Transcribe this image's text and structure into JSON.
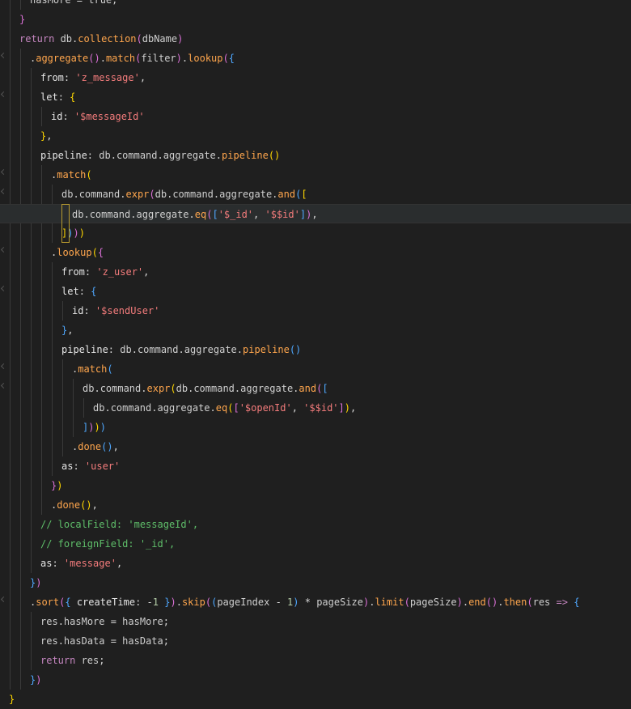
{
  "editor": {
    "lines": [
      {
        "indent": 3,
        "tokens": [
          {
            "t": "hasMore = true;",
            "c": "default"
          }
        ]
      },
      {
        "indent": 2,
        "tokens": [
          {
            "t": "}",
            "c": "bracket2"
          }
        ]
      },
      {
        "indent": 2,
        "tokens": [
          {
            "t": "return ",
            "c": "keyword"
          },
          {
            "t": "db",
            "c": "default"
          },
          {
            "t": ".",
            "c": "punct"
          },
          {
            "t": "collection",
            "c": "function"
          },
          {
            "t": "(",
            "c": "bracket2"
          },
          {
            "t": "dbName",
            "c": "default"
          },
          {
            "t": ")",
            "c": "bracket2"
          }
        ]
      },
      {
        "indent": 3,
        "fold": true,
        "tokens": [
          {
            "t": ".",
            "c": "punct"
          },
          {
            "t": "aggregate",
            "c": "function"
          },
          {
            "t": "()",
            "c": "bracket2"
          },
          {
            "t": ".",
            "c": "punct"
          },
          {
            "t": "match",
            "c": "function"
          },
          {
            "t": "(",
            "c": "bracket2"
          },
          {
            "t": "filter",
            "c": "default"
          },
          {
            "t": ")",
            "c": "bracket2"
          },
          {
            "t": ".",
            "c": "punct"
          },
          {
            "t": "lookup",
            "c": "function"
          },
          {
            "t": "(",
            "c": "bracket2"
          },
          {
            "t": "{",
            "c": "bracket3"
          }
        ]
      },
      {
        "indent": 4,
        "tokens": [
          {
            "t": "from",
            "c": "property"
          },
          {
            "t": ": ",
            "c": "punct"
          },
          {
            "t": "'z_message'",
            "c": "string"
          },
          {
            "t": ",",
            "c": "punct"
          }
        ]
      },
      {
        "indent": 4,
        "fold": true,
        "tokens": [
          {
            "t": "let",
            "c": "property"
          },
          {
            "t": ": ",
            "c": "punct"
          },
          {
            "t": "{",
            "c": "bracket1"
          }
        ]
      },
      {
        "indent": 5,
        "tokens": [
          {
            "t": "id",
            "c": "property"
          },
          {
            "t": ": ",
            "c": "punct"
          },
          {
            "t": "'$messageId'",
            "c": "string"
          }
        ]
      },
      {
        "indent": 4,
        "tokens": [
          {
            "t": "}",
            "c": "bracket1"
          },
          {
            "t": ",",
            "c": "punct"
          }
        ]
      },
      {
        "indent": 4,
        "tokens": [
          {
            "t": "pipeline",
            "c": "property"
          },
          {
            "t": ": ",
            "c": "punct"
          },
          {
            "t": "db",
            "c": "default"
          },
          {
            "t": ".",
            "c": "punct"
          },
          {
            "t": "command",
            "c": "default"
          },
          {
            "t": ".",
            "c": "punct"
          },
          {
            "t": "aggregate",
            "c": "default"
          },
          {
            "t": ".",
            "c": "punct"
          },
          {
            "t": "pipeline",
            "c": "function"
          },
          {
            "t": "()",
            "c": "bracket1"
          }
        ]
      },
      {
        "indent": 5,
        "fold": true,
        "tokens": [
          {
            "t": ".",
            "c": "punct"
          },
          {
            "t": "match",
            "c": "function"
          },
          {
            "t": "(",
            "c": "bracket1"
          }
        ]
      },
      {
        "indent": 6,
        "fold": true,
        "tokens": [
          {
            "t": "db",
            "c": "default"
          },
          {
            "t": ".",
            "c": "punct"
          },
          {
            "t": "command",
            "c": "default"
          },
          {
            "t": ".",
            "c": "punct"
          },
          {
            "t": "expr",
            "c": "function"
          },
          {
            "t": "(",
            "c": "bracket2"
          },
          {
            "t": "db",
            "c": "default"
          },
          {
            "t": ".",
            "c": "punct"
          },
          {
            "t": "command",
            "c": "default"
          },
          {
            "t": ".",
            "c": "punct"
          },
          {
            "t": "aggregate",
            "c": "default"
          },
          {
            "t": ".",
            "c": "punct"
          },
          {
            "t": "and",
            "c": "function"
          },
          {
            "t": "(",
            "c": "bracket3"
          },
          {
            "t": "[",
            "c": "bracket1"
          }
        ]
      },
      {
        "indent": 7,
        "current": true,
        "tokens": [
          {
            "t": "db",
            "c": "default"
          },
          {
            "t": ".",
            "c": "punct"
          },
          {
            "t": "command",
            "c": "default"
          },
          {
            "t": ".",
            "c": "punct"
          },
          {
            "t": "aggregate",
            "c": "default"
          },
          {
            "t": ".",
            "c": "punct"
          },
          {
            "t": "eq",
            "c": "function"
          },
          {
            "t": "(",
            "c": "bracket2"
          },
          {
            "t": "[",
            "c": "bracket3"
          },
          {
            "t": "'$_id'",
            "c": "string"
          },
          {
            "t": ", ",
            "c": "punct"
          },
          {
            "t": "'$$id'",
            "c": "string"
          },
          {
            "t": "]",
            "c": "bracket3"
          },
          {
            "t": ")",
            "c": "bracket2"
          },
          {
            "t": ",",
            "c": "punct"
          }
        ]
      },
      {
        "indent": 6,
        "tokens": [
          {
            "t": "]",
            "c": "bracket1"
          },
          {
            "t": ")",
            "c": "bracket3"
          },
          {
            "t": ")",
            "c": "bracket2"
          },
          {
            "t": ")",
            "c": "bracket1"
          }
        ]
      },
      {
        "indent": 5,
        "fold": true,
        "tokens": [
          {
            "t": ".",
            "c": "punct"
          },
          {
            "t": "lookup",
            "c": "function"
          },
          {
            "t": "(",
            "c": "bracket1"
          },
          {
            "t": "{",
            "c": "bracket2"
          }
        ]
      },
      {
        "indent": 6,
        "tokens": [
          {
            "t": "from",
            "c": "property"
          },
          {
            "t": ": ",
            "c": "punct"
          },
          {
            "t": "'z_user'",
            "c": "string"
          },
          {
            "t": ",",
            "c": "punct"
          }
        ]
      },
      {
        "indent": 6,
        "fold": true,
        "tokens": [
          {
            "t": "let",
            "c": "property"
          },
          {
            "t": ": ",
            "c": "punct"
          },
          {
            "t": "{",
            "c": "bracket3"
          }
        ]
      },
      {
        "indent": 7,
        "tokens": [
          {
            "t": "id",
            "c": "property"
          },
          {
            "t": ": ",
            "c": "punct"
          },
          {
            "t": "'$sendUser'",
            "c": "string"
          }
        ]
      },
      {
        "indent": 6,
        "tokens": [
          {
            "t": "}",
            "c": "bracket3"
          },
          {
            "t": ",",
            "c": "punct"
          }
        ]
      },
      {
        "indent": 6,
        "tokens": [
          {
            "t": "pipeline",
            "c": "property"
          },
          {
            "t": ": ",
            "c": "punct"
          },
          {
            "t": "db",
            "c": "default"
          },
          {
            "t": ".",
            "c": "punct"
          },
          {
            "t": "command",
            "c": "default"
          },
          {
            "t": ".",
            "c": "punct"
          },
          {
            "t": "aggregate",
            "c": "default"
          },
          {
            "t": ".",
            "c": "punct"
          },
          {
            "t": "pipeline",
            "c": "function"
          },
          {
            "t": "()",
            "c": "bracket3"
          }
        ]
      },
      {
        "indent": 7,
        "fold": true,
        "tokens": [
          {
            "t": ".",
            "c": "punct"
          },
          {
            "t": "match",
            "c": "function"
          },
          {
            "t": "(",
            "c": "bracket3"
          }
        ]
      },
      {
        "indent": 8,
        "fold": true,
        "tokens": [
          {
            "t": "db",
            "c": "default"
          },
          {
            "t": ".",
            "c": "punct"
          },
          {
            "t": "command",
            "c": "default"
          },
          {
            "t": ".",
            "c": "punct"
          },
          {
            "t": "expr",
            "c": "function"
          },
          {
            "t": "(",
            "c": "bracket1"
          },
          {
            "t": "db",
            "c": "default"
          },
          {
            "t": ".",
            "c": "punct"
          },
          {
            "t": "command",
            "c": "default"
          },
          {
            "t": ".",
            "c": "punct"
          },
          {
            "t": "aggregate",
            "c": "default"
          },
          {
            "t": ".",
            "c": "punct"
          },
          {
            "t": "and",
            "c": "function"
          },
          {
            "t": "(",
            "c": "bracket2"
          },
          {
            "t": "[",
            "c": "bracket3"
          }
        ]
      },
      {
        "indent": 9,
        "tokens": [
          {
            "t": "db",
            "c": "default"
          },
          {
            "t": ".",
            "c": "punct"
          },
          {
            "t": "command",
            "c": "default"
          },
          {
            "t": ".",
            "c": "punct"
          },
          {
            "t": "aggregate",
            "c": "default"
          },
          {
            "t": ".",
            "c": "punct"
          },
          {
            "t": "eq",
            "c": "function"
          },
          {
            "t": "(",
            "c": "bracket1"
          },
          {
            "t": "[",
            "c": "bracket2"
          },
          {
            "t": "'$openId'",
            "c": "string"
          },
          {
            "t": ", ",
            "c": "punct"
          },
          {
            "t": "'$$id'",
            "c": "string"
          },
          {
            "t": "]",
            "c": "bracket2"
          },
          {
            "t": ")",
            "c": "bracket1"
          },
          {
            "t": ",",
            "c": "punct"
          }
        ]
      },
      {
        "indent": 8,
        "tokens": [
          {
            "t": "]",
            "c": "bracket3"
          },
          {
            "t": ")",
            "c": "bracket2"
          },
          {
            "t": ")",
            "c": "bracket1"
          },
          {
            "t": ")",
            "c": "bracket3"
          }
        ]
      },
      {
        "indent": 7,
        "tokens": [
          {
            "t": ".",
            "c": "punct"
          },
          {
            "t": "done",
            "c": "function"
          },
          {
            "t": "()",
            "c": "bracket3"
          },
          {
            "t": ",",
            "c": "punct"
          }
        ]
      },
      {
        "indent": 6,
        "tokens": [
          {
            "t": "as",
            "c": "property"
          },
          {
            "t": ": ",
            "c": "punct"
          },
          {
            "t": "'user'",
            "c": "string"
          }
        ]
      },
      {
        "indent": 5,
        "tokens": [
          {
            "t": "}",
            "c": "bracket2"
          },
          {
            "t": ")",
            "c": "bracket1"
          }
        ]
      },
      {
        "indent": 5,
        "tokens": [
          {
            "t": ".",
            "c": "punct"
          },
          {
            "t": "done",
            "c": "function"
          },
          {
            "t": "()",
            "c": "bracket1"
          },
          {
            "t": ",",
            "c": "punct"
          }
        ]
      },
      {
        "indent": 4,
        "tokens": [
          {
            "t": "// localField: ",
            "c": "comment"
          },
          {
            "t": "'messageId'",
            "c": "comment"
          },
          {
            "t": ",",
            "c": "comment"
          }
        ]
      },
      {
        "indent": 4,
        "tokens": [
          {
            "t": "// foreignField: ",
            "c": "comment"
          },
          {
            "t": "'_id'",
            "c": "comment"
          },
          {
            "t": ",",
            "c": "comment"
          }
        ]
      },
      {
        "indent": 4,
        "tokens": [
          {
            "t": "as",
            "c": "property"
          },
          {
            "t": ": ",
            "c": "punct"
          },
          {
            "t": "'message'",
            "c": "string"
          },
          {
            "t": ",",
            "c": "punct"
          }
        ]
      },
      {
        "indent": 3,
        "tokens": [
          {
            "t": "}",
            "c": "bracket3"
          },
          {
            "t": ")",
            "c": "bracket2"
          }
        ]
      },
      {
        "indent": 3,
        "fold": true,
        "tokens": [
          {
            "t": ".",
            "c": "punct"
          },
          {
            "t": "sort",
            "c": "function"
          },
          {
            "t": "(",
            "c": "bracket2"
          },
          {
            "t": "{",
            "c": "bracket3"
          },
          {
            "t": " createTime",
            "c": "property"
          },
          {
            "t": ": ",
            "c": "punct"
          },
          {
            "t": "-",
            "c": "operator"
          },
          {
            "t": "1",
            "c": "number"
          },
          {
            "t": " ",
            "c": "punct"
          },
          {
            "t": "}",
            "c": "bracket3"
          },
          {
            "t": ")",
            "c": "bracket2"
          },
          {
            "t": ".",
            "c": "punct"
          },
          {
            "t": "skip",
            "c": "function"
          },
          {
            "t": "(",
            "c": "bracket2"
          },
          {
            "t": "(",
            "c": "bracket3"
          },
          {
            "t": "pageIndex ",
            "c": "default"
          },
          {
            "t": "- ",
            "c": "operator"
          },
          {
            "t": "1",
            "c": "number"
          },
          {
            "t": ")",
            "c": "bracket3"
          },
          {
            "t": " * ",
            "c": "operator"
          },
          {
            "t": "pageSize",
            "c": "default"
          },
          {
            "t": ")",
            "c": "bracket2"
          },
          {
            "t": ".",
            "c": "punct"
          },
          {
            "t": "limit",
            "c": "function"
          },
          {
            "t": "(",
            "c": "bracket2"
          },
          {
            "t": "pageSize",
            "c": "default"
          },
          {
            "t": ")",
            "c": "bracket2"
          },
          {
            "t": ".",
            "c": "punct"
          },
          {
            "t": "end",
            "c": "function"
          },
          {
            "t": "()",
            "c": "bracket2"
          },
          {
            "t": ".",
            "c": "punct"
          },
          {
            "t": "then",
            "c": "function"
          },
          {
            "t": "(",
            "c": "bracket2"
          },
          {
            "t": "res ",
            "c": "default"
          },
          {
            "t": "=>",
            "c": "arrow"
          },
          {
            "t": " ",
            "c": "punct"
          },
          {
            "t": "{",
            "c": "bracket3"
          }
        ]
      },
      {
        "indent": 4,
        "tokens": [
          {
            "t": "res",
            "c": "default"
          },
          {
            "t": ".",
            "c": "punct"
          },
          {
            "t": "hasMore ",
            "c": "default"
          },
          {
            "t": "= ",
            "c": "operator"
          },
          {
            "t": "hasMore",
            "c": "default"
          },
          {
            "t": ";",
            "c": "punct"
          }
        ]
      },
      {
        "indent": 4,
        "tokens": [
          {
            "t": "res",
            "c": "default"
          },
          {
            "t": ".",
            "c": "punct"
          },
          {
            "t": "hasData ",
            "c": "default"
          },
          {
            "t": "= ",
            "c": "operator"
          },
          {
            "t": "hasData",
            "c": "default"
          },
          {
            "t": ";",
            "c": "punct"
          }
        ]
      },
      {
        "indent": 4,
        "tokens": [
          {
            "t": "return ",
            "c": "keyword"
          },
          {
            "t": "res",
            "c": "default"
          },
          {
            "t": ";",
            "c": "punct"
          }
        ]
      },
      {
        "indent": 3,
        "tokens": [
          {
            "t": "}",
            "c": "bracket3"
          },
          {
            "t": ")",
            "c": "bracket2"
          }
        ]
      },
      {
        "indent": 1,
        "tokens": [
          {
            "t": "}",
            "c": "bracket1"
          }
        ]
      }
    ]
  }
}
